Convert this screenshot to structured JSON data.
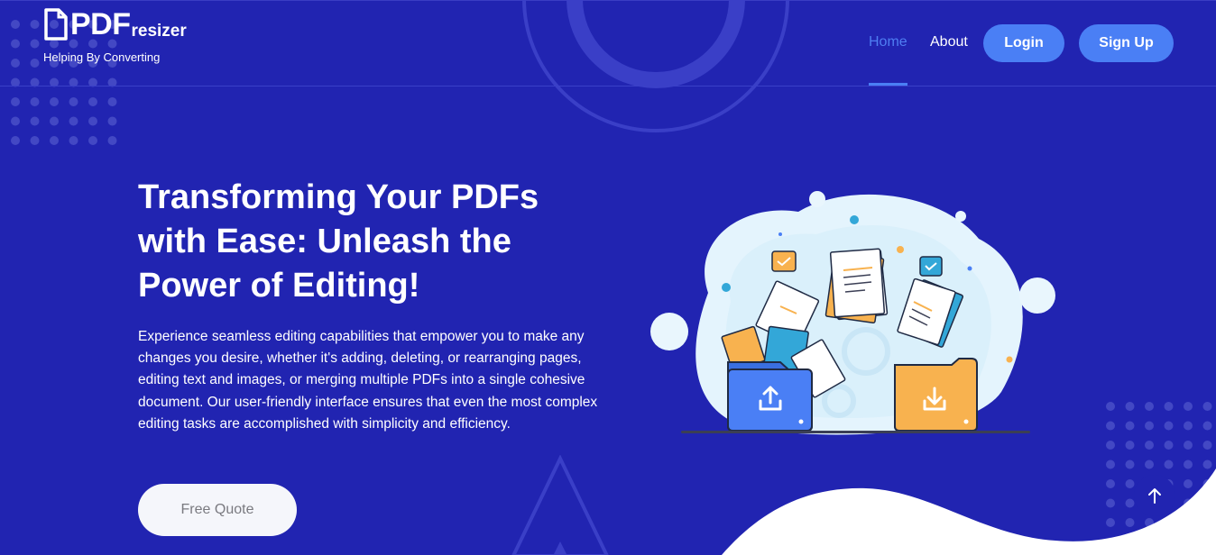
{
  "brand": {
    "logo_main": "PDF",
    "logo_sub": "resizer",
    "tagline": "Helping By Converting"
  },
  "nav": {
    "home": "Home",
    "about": "About",
    "login": "Login",
    "signup": "Sign Up"
  },
  "hero": {
    "title": "Transforming Your PDFs with Ease: Unleash the Power of Editing!",
    "description": "Experience seamless editing capabilities that empower you to make any changes you desire, whether it's adding, deleting, or rearranging pages, editing text and images, or merging multiple PDFs into a single cohesive document. Our user-friendly interface ensures that even the most complex editing tasks are accomplished with simplicity and efficiency.",
    "cta": "Free Quote"
  },
  "icons": {
    "logo": "document-icon",
    "back_to_top": "arrow-up-icon",
    "upload": "upload-icon",
    "download": "download-icon"
  },
  "colors": {
    "background": "#2124b1",
    "accent": "#4a7ff5",
    "cta_bg": "#f5f6fb",
    "folder_blue": "#4a7ff5",
    "folder_orange": "#f8b24f"
  }
}
